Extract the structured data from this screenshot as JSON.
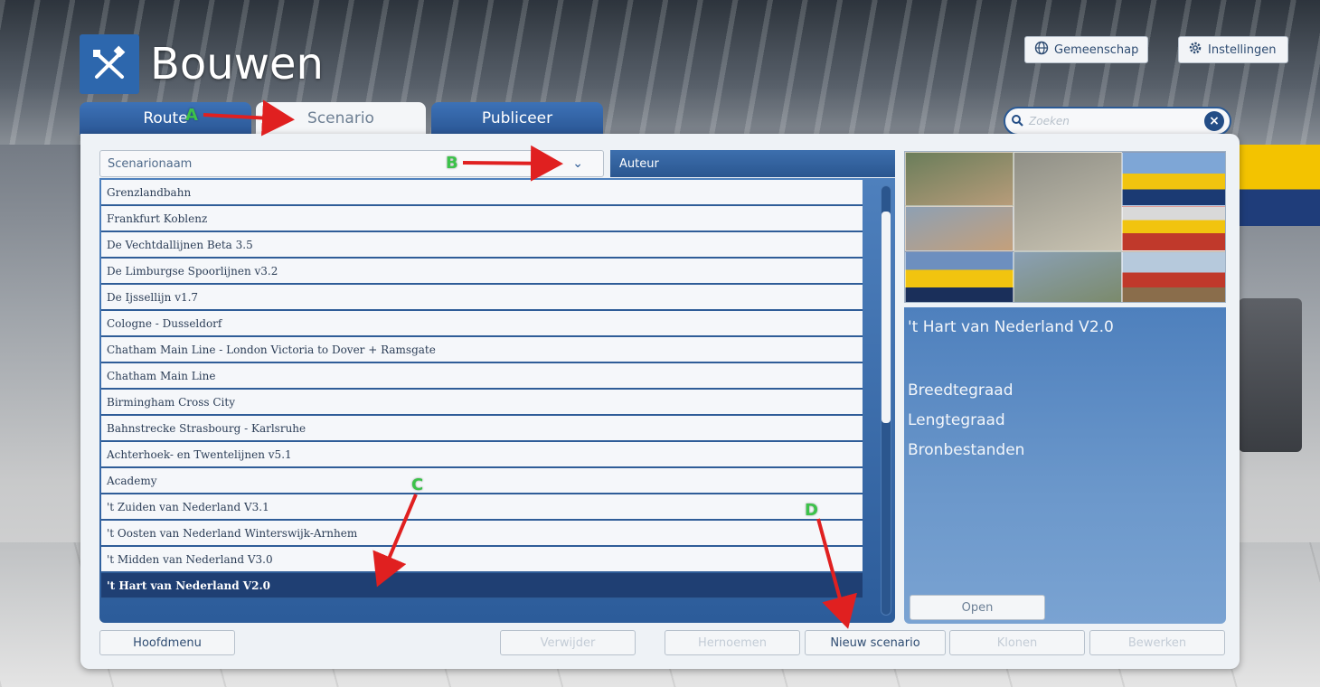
{
  "app": {
    "title": "Bouwen"
  },
  "header": {
    "community_label": "Gemeenschap",
    "settings_label": "Instellingen"
  },
  "tabs": [
    {
      "label": "Route"
    },
    {
      "label": "Scenario"
    },
    {
      "label": "Publiceer"
    }
  ],
  "search": {
    "placeholder": "Zoeken"
  },
  "filters": {
    "name_label": "Scenarionaam",
    "author_label": "Auteur"
  },
  "routes": [
    "Grenzlandbahn",
    "Frankfurt Koblenz",
    "De Vechtdallijnen Beta 3.5",
    "De Limburgse Spoorlijnen v3.2",
    "De Ijssellijn v1.7",
    "Cologne - Dusseldorf",
    "Chatham Main Line - London Victoria to Dover + Ramsgate",
    "Chatham Main Line",
    "Birmingham Cross City",
    "Bahnstrecke Strasbourg - Karlsruhe",
    "Achterhoek- en Twentelijnen v5.1",
    "Academy",
    "'t Zuiden van Nederland V3.1",
    "'t Oosten van Nederland Winterswijk-Arnhem",
    "'t Midden van Nederland V3.0",
    "'t Hart van Nederland V2.0"
  ],
  "selected_index": 15,
  "detail": {
    "name": "'t Hart van Nederland V2.0",
    "latitude_label": "Breedtegraad",
    "longitude_label": "Lengtegraad",
    "sources_label": "Bronbestanden",
    "open_label": "Open"
  },
  "bottom": {
    "main_menu": "Hoofdmenu",
    "delete": "Verwijder",
    "rename": "Hernoemen",
    "new_scenario": "Nieuw scenario",
    "clone": "Klonen",
    "edit": "Bewerken"
  },
  "annotations": {
    "a": "A",
    "b": "B",
    "c": "C",
    "d": "D"
  },
  "colors": {
    "accent": "#2d67ad",
    "selected_row": "#1f3f73",
    "annotation_arrow": "#e02020",
    "annotation_letter": "#3cc24a"
  }
}
